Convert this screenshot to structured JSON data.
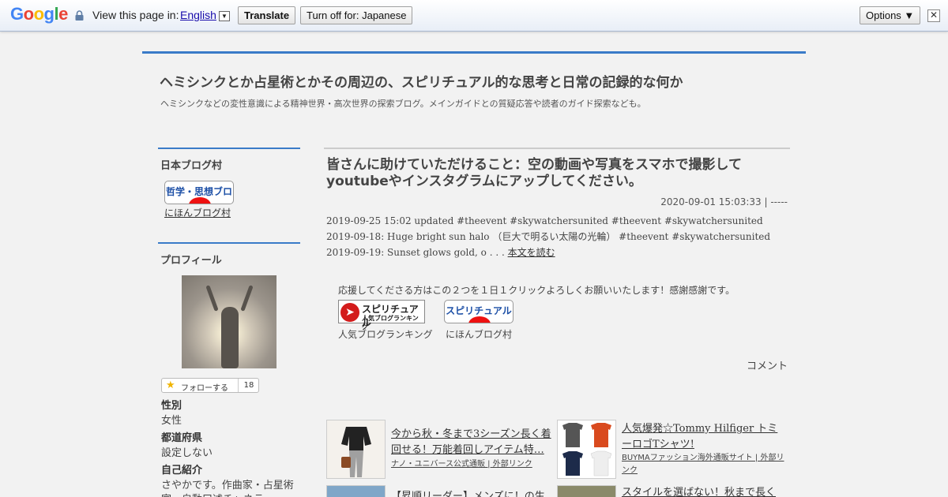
{
  "translate_bar": {
    "logo": {
      "g1": "G",
      "o1": "o",
      "o2": "o",
      "g2": "g",
      "l": "l",
      "e": "e"
    },
    "prefix": "View this page in:",
    "language": "English",
    "translate_button": "Translate",
    "turn_off_button": "Turn off for: Japanese",
    "options_button": "Options ▼",
    "close": "✕"
  },
  "site": {
    "title": "ヘミシンクとか占星術とかその周辺の、スピリチュアル的な思考と日常の記録的な何か",
    "description": "ヘミシンクなどの変性意識による精神世界・高次世界の探索ブログ。メインガイドとの質疑応答や読者のガイド探索なども。"
  },
  "sidebar": {
    "blog_village": {
      "heading": "日本ブログ村",
      "badge_text": "哲学・思想ブログ",
      "link": "にほんブログ村"
    },
    "profile": {
      "heading": "プロフィール",
      "follow_label": "フォローする",
      "follow_count": "18",
      "fields": [
        {
          "key": "性別",
          "value": "女性"
        },
        {
          "key": "都道府県",
          "value": "設定しない"
        },
        {
          "key": "自己紹介",
          "value": "さやかです。作曲家・占星術"
        },
        {
          "key": "",
          "value": "家・自動口述チャネラー"
        }
      ]
    }
  },
  "article": {
    "title": "皆さんに助けていただけること：空の動画や写真をスマホで撮影して youtubeやインスタグラムにアップしてください。",
    "date": "2020-09-01 15:03:33 | -----",
    "body": "2019-09-25 15:02 updated #theevent #skywatchersunited #theevent #skywatchersunited 2019-09-18: Huge bright sun halo （巨大で明るい太陽の光輪） #theevent #skywatchersunited 2019-09-19: Sunset glows gold, o . . . ",
    "read_more": "本文を読む",
    "support_text": "応援してくださる方はこの２つを１日１クリックよろしくお願いいたします！感謝感謝です。",
    "rank1_text": "スピリチュアル",
    "rank1_sub": "人気ブログランキング",
    "rank1_label": "人気ブログランキング",
    "rank2_text": "スピリチュアル",
    "rank2_label": "にほんブログ村",
    "comment": "コメント"
  },
  "ads": [
    {
      "title": "今から秋・冬まで3シーズン長く着回せる！万能着回しアイテム特…",
      "source": "ナノ・ユニバース公式通販 | 外部リンク"
    },
    {
      "title": "人気爆発☆Tommy Hilfiger トミーロゴTシャツ!",
      "source": "BUYMAファッション海外通販サイト | 外部リンク"
    },
    {
      "title": "【昇順リーダー】メンズに！の生活",
      "source": ""
    },
    {
      "title": "スタイルを選ばない！秋まで長く",
      "source": ""
    }
  ]
}
